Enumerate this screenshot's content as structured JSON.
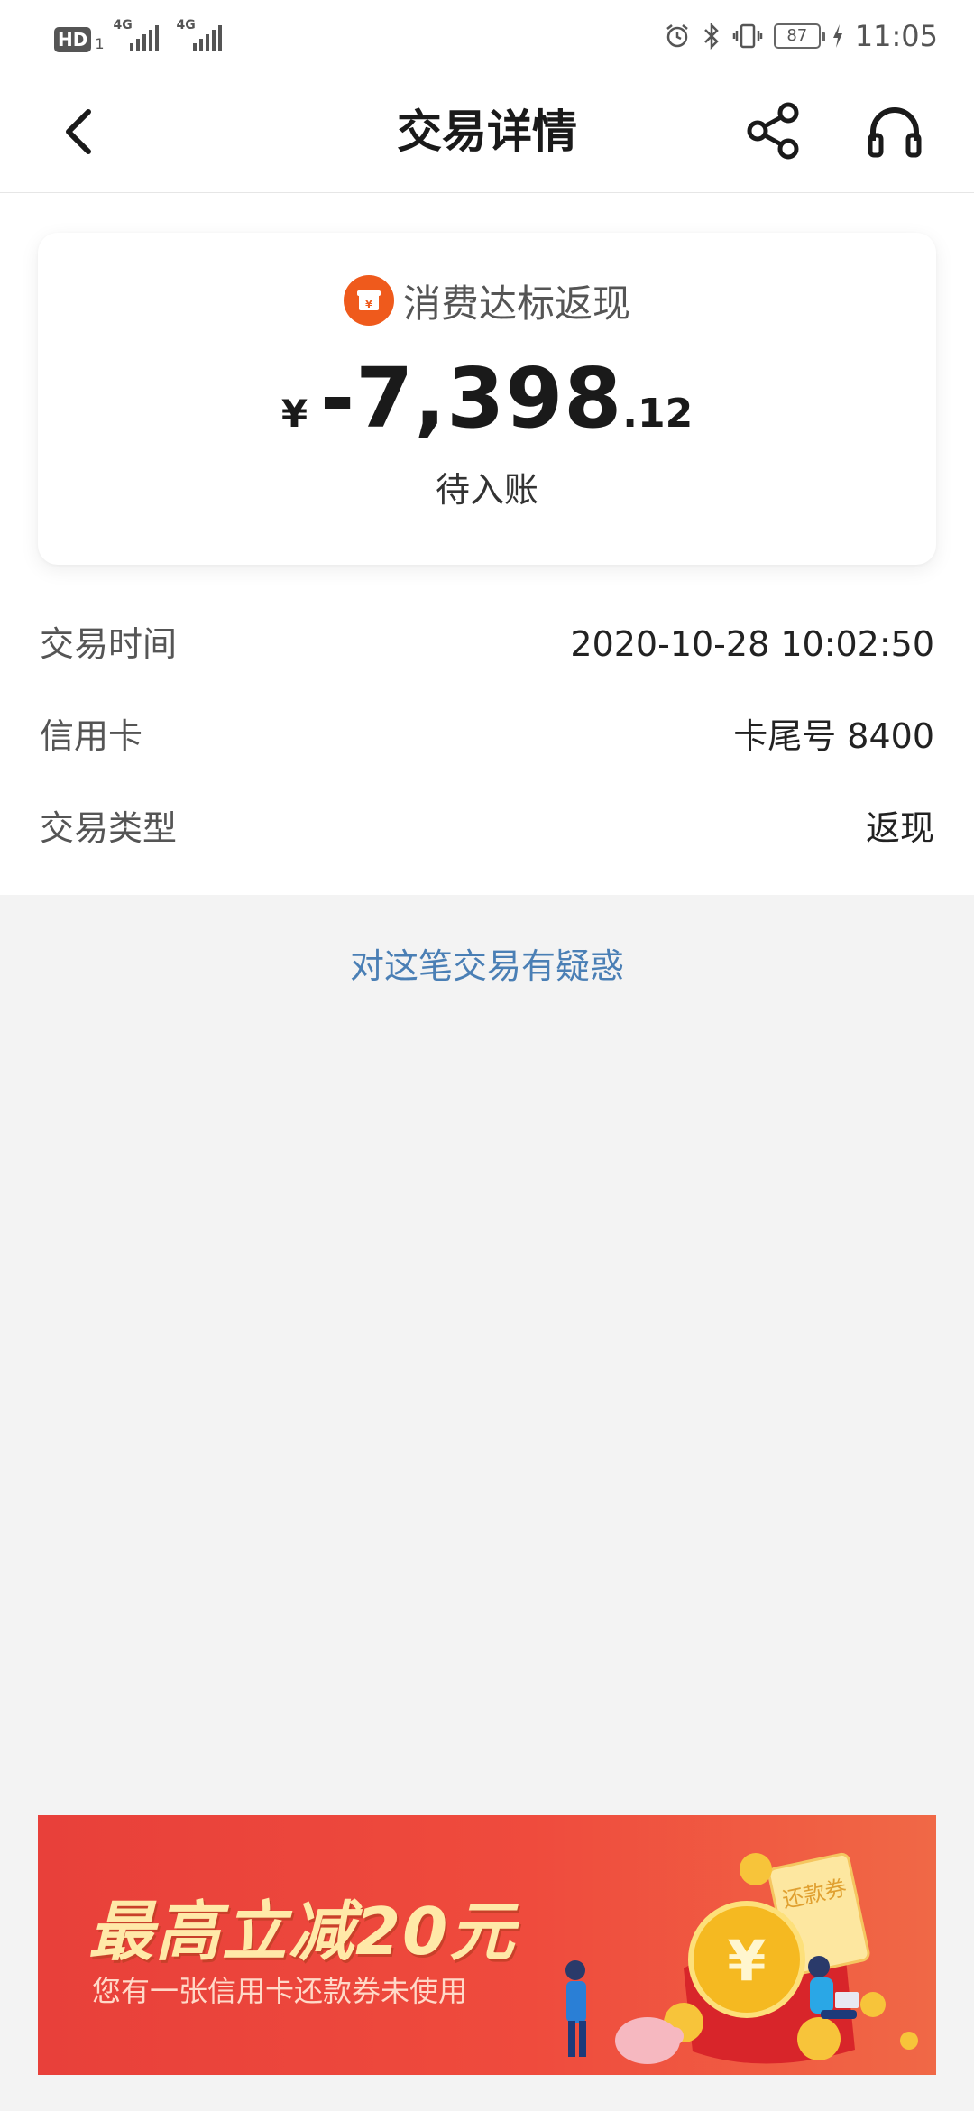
{
  "status_bar": {
    "hd": "HD",
    "sim": "1",
    "net1": "4G",
    "net2": "4G",
    "battery": "87",
    "time": "11:05"
  },
  "header": {
    "title": "交易详情"
  },
  "summary": {
    "merchant": "消费达标返现",
    "currency": "¥",
    "amount_int": "-7,398",
    "amount_dec": ".12",
    "status": "待入账",
    "icon_color": "#ef5a1c"
  },
  "details": [
    {
      "label": "交易时间",
      "value": "2020-10-28 10:02:50"
    },
    {
      "label": "信用卡",
      "value": "卡尾号 8400"
    },
    {
      "label": "交易类型",
      "value": "返现"
    }
  ],
  "question_link": "对这笔交易有疑惑",
  "banner": {
    "title": "最高立减20元",
    "subtitle": "您有一张信用卡还款券未使用",
    "coin_text": "¥",
    "coupon_text": "还款券"
  },
  "colors": {
    "accent_link": "#4a7fb5",
    "banner_red": "#e8403a",
    "banner_gold": "#ffe9a8"
  }
}
